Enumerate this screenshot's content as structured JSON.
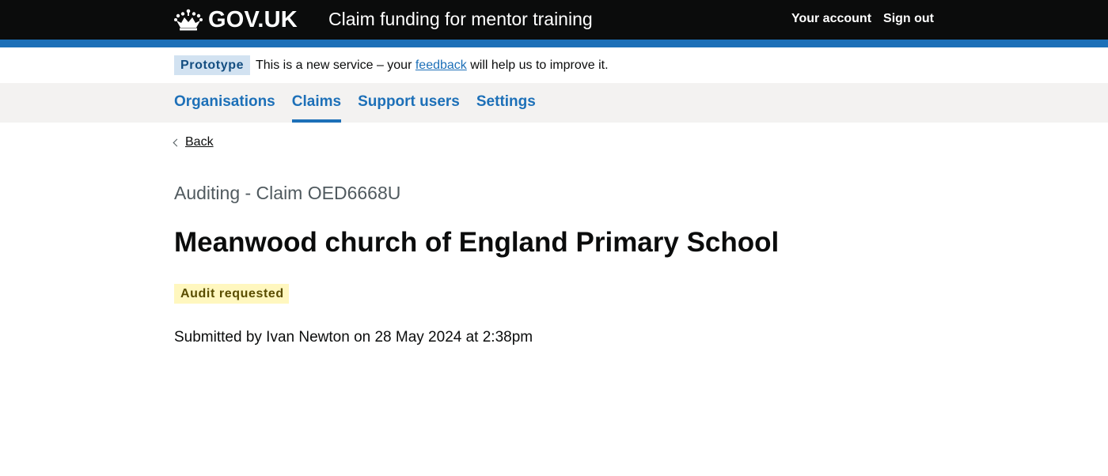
{
  "header": {
    "logo_text": "GOV.UK",
    "service_name": "Claim funding for mentor training",
    "nav": [
      "Your account",
      "Sign out"
    ]
  },
  "phase_banner": {
    "tag": "Prototype",
    "text_before": "This is a new service – your ",
    "link": "feedback",
    "text_after": " will help us to improve it."
  },
  "primary_nav": {
    "items": [
      "Organisations",
      "Claims",
      "Support users",
      "Settings"
    ],
    "current": "Claims"
  },
  "back_link": "Back",
  "caption": "Auditing - Claim OED6668U",
  "title": "Meanwood church of England Primary School",
  "status_tag": "Audit requested",
  "submitted_text": "Submitted by Ivan Newton on 28 May 2024 at 2:38pm",
  "colors": {
    "header_bg": "#0b0c0c",
    "brand_blue": "#1d70b8",
    "phase_tag_bg": "#d2e2f1",
    "nav_bg": "#f3f2f1",
    "status_tag_bg": "#fff7bf",
    "status_tag_text": "#594d00"
  }
}
